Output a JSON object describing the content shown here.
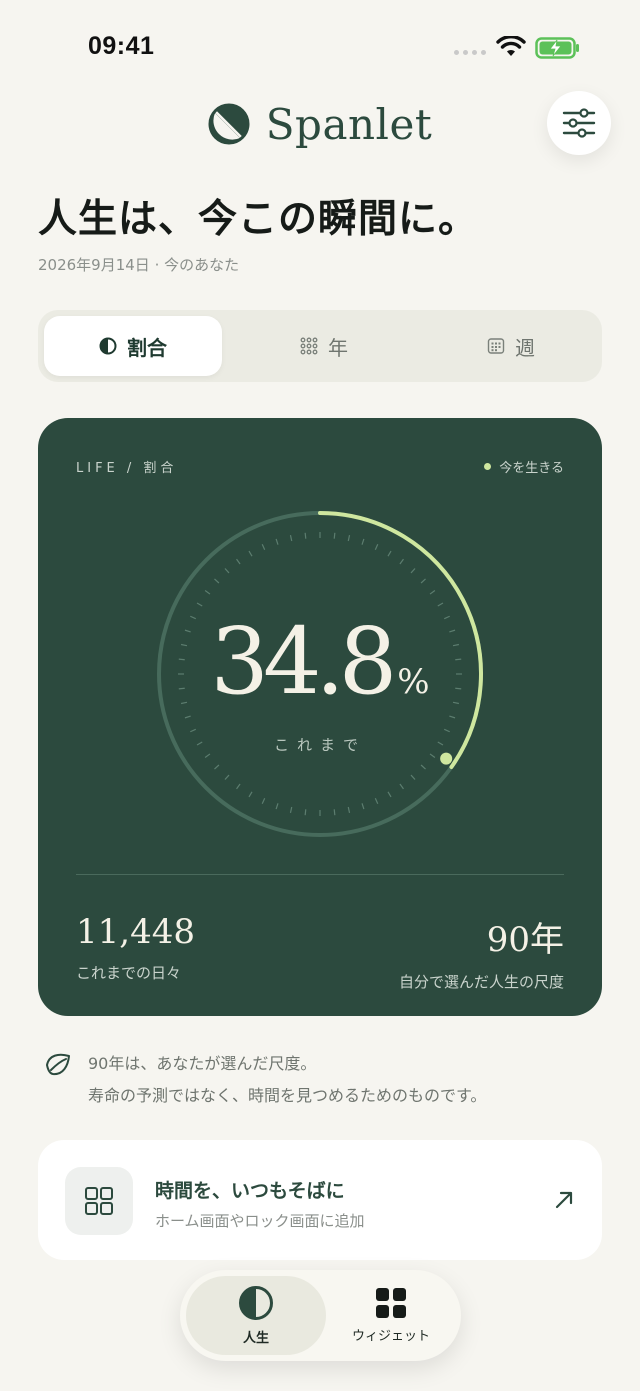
{
  "status": {
    "time": "09:41"
  },
  "brand": {
    "name": "Spanlet"
  },
  "headline": "人生は、今この瞬間に。",
  "subhead": "2026年9月14日 · 今のあなた",
  "segments": [
    {
      "label": "割合",
      "icon": "half-circle-icon",
      "active": true
    },
    {
      "label": "年",
      "icon": "dot-grid-icon",
      "active": false
    },
    {
      "label": "週",
      "icon": "calendar-grid-icon",
      "active": false
    }
  ],
  "card": {
    "label": "LIFE / 割合",
    "live": "今を生きる",
    "percent": "34.8",
    "percent_symbol": "%",
    "progress": 0.348,
    "caption": "これまで",
    "days_value": "11,448",
    "days_caption": "これまでの日々",
    "years_value": "90年",
    "years_caption": "自分で選んだ人生の尺度",
    "colors": {
      "background": "#2c4a3e",
      "accent": "#cfe79f"
    }
  },
  "note": {
    "icon": "leaf-icon",
    "line1": "90年は、あなたが選んだ尺度。",
    "line2": "寿命の予測ではなく、時間を見つめるためのものです。"
  },
  "widget": {
    "title": "時間を、いつもそばに",
    "subtitle": "ホーム画面やロック画面に追加",
    "icon": "widget-grid-icon",
    "arrow_icon": "arrow-up-right-icon"
  },
  "tabs": [
    {
      "label": "人生",
      "icon": "half-circle-icon",
      "active": true
    },
    {
      "label": "ウィジェット",
      "icon": "four-squares-icon",
      "active": false
    }
  ]
}
